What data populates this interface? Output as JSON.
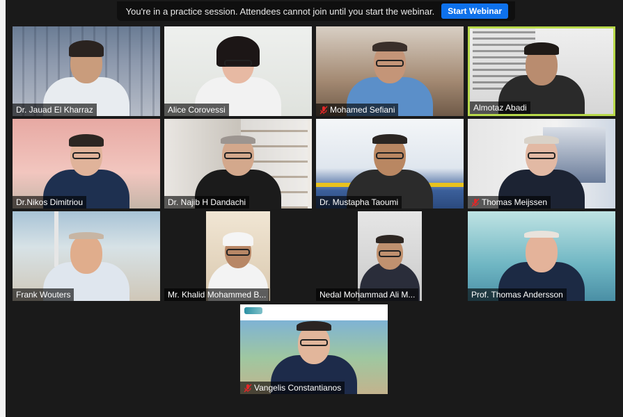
{
  "banner": {
    "message": "You're in a practice session. Attendees cannot join until you start the webinar.",
    "start_label": "Start Webinar"
  },
  "participants": [
    {
      "name": "Dr. Jauad El Kharraz",
      "muted": false
    },
    {
      "name": "Alice Corovessi",
      "muted": false
    },
    {
      "name": "Mohamed Sefiani",
      "muted": true
    },
    {
      "name": "Almotaz Abadi",
      "muted": false,
      "active_speaker": true
    },
    {
      "name": "Dr.Nikos Dimitriou",
      "muted": false
    },
    {
      "name": "Dr. Najib H Dandachi",
      "muted": false
    },
    {
      "name": "Dr. Mustapha Taoumi",
      "muted": false
    },
    {
      "name": "Thomas Meijssen",
      "muted": true
    },
    {
      "name": "Frank Wouters",
      "muted": false
    },
    {
      "name": "Mr. Khalid Mohammed B...",
      "muted": false
    },
    {
      "name": "Nedal Mohammad Ali M...",
      "muted": false
    },
    {
      "name": "Prof. Thomas Andersson",
      "muted": false
    },
    {
      "name": "Vangelis Constantianos",
      "muted": true
    }
  ],
  "colors": {
    "accent": "#0e71eb",
    "active_border": "#b8d94a",
    "muted_icon": "#e02828"
  },
  "icons": {
    "muted": "mic-off-icon"
  }
}
